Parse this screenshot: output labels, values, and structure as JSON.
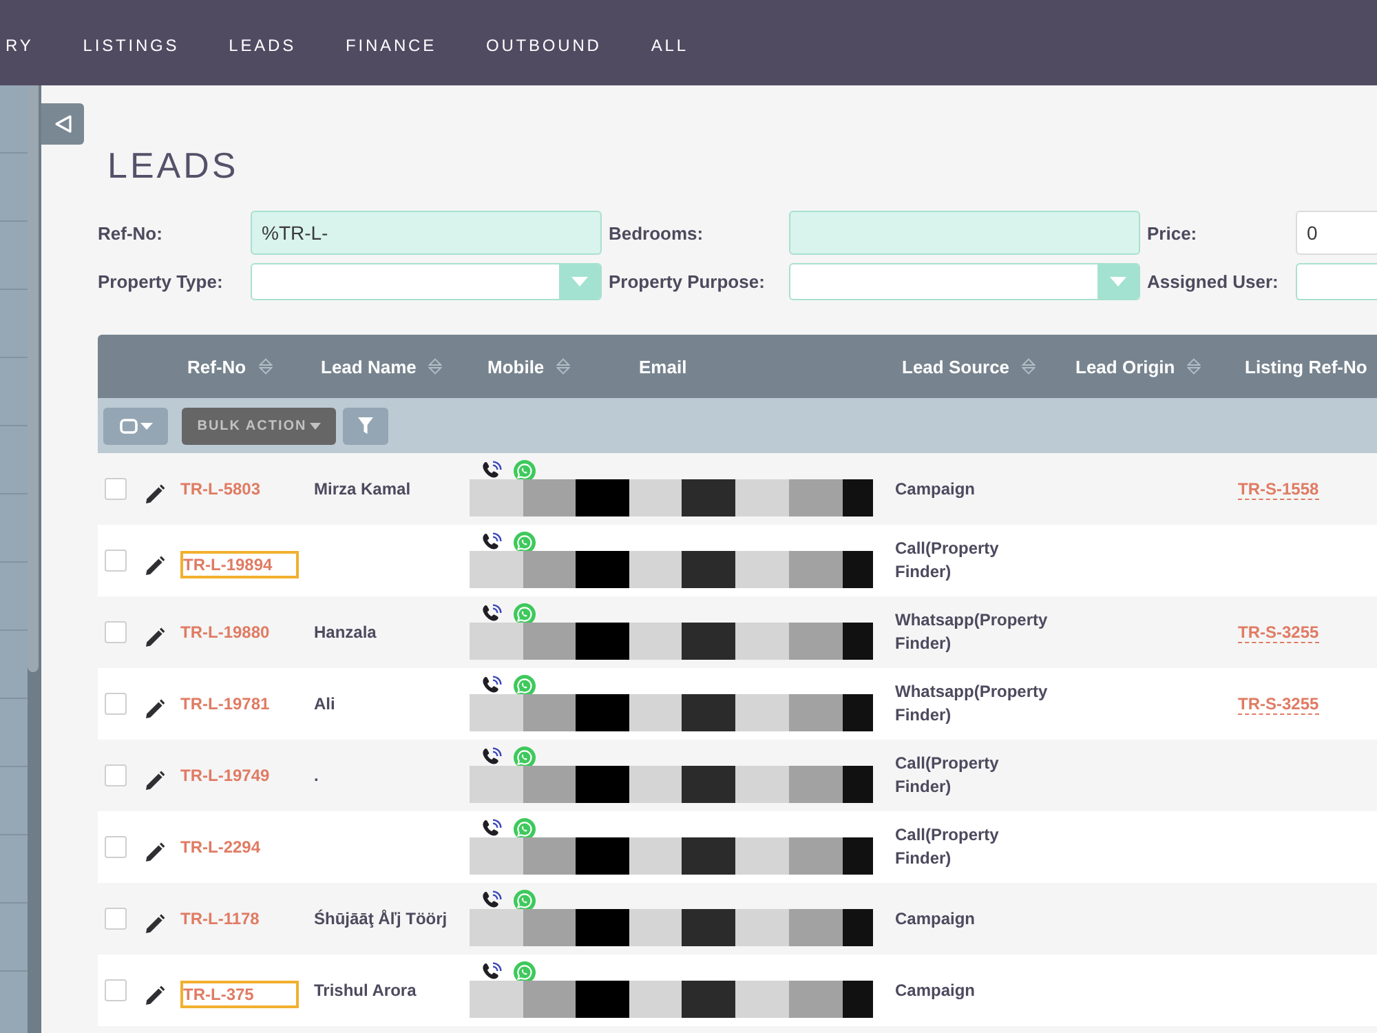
{
  "top_nav": {
    "items": [
      "RY",
      "LISTINGS",
      "LEADS",
      "FINANCE",
      "OUTBOUND",
      "ALL"
    ]
  },
  "page": {
    "title": "LEADS"
  },
  "filters": [
    {
      "label": "Ref-No:",
      "kind": "text",
      "highlighted": true,
      "value": "%TR-L-"
    },
    {
      "label": "Bedrooms:",
      "kind": "text",
      "highlighted": true
    },
    {
      "label": "Price:",
      "kind": "text",
      "highlighted": false,
      "value": "0"
    },
    {
      "label": "Property Type:",
      "kind": "select",
      "highlighted": false
    },
    {
      "label": "Property Purpose:",
      "kind": "select",
      "highlighted": false
    },
    {
      "label": "Assigned User:",
      "kind": "lookup",
      "highlighted": false
    }
  ],
  "table": {
    "columns": [
      {
        "label": "Ref-No",
        "sortable": true
      },
      {
        "label": "Lead Name",
        "sortable": true
      },
      {
        "label": "Mobile",
        "sortable": true
      },
      {
        "label": "Email",
        "sortable": false
      },
      {
        "label": "Lead Source",
        "sortable": true
      },
      {
        "label": "Lead Origin",
        "sortable": true
      },
      {
        "label": "Listing Ref-No",
        "sortable": false
      }
    ],
    "bulk_action": {
      "label": "BULK ACTION",
      "disabled": true
    },
    "rows": [
      {
        "checked": false,
        "ref": "TR-L-5803",
        "outlined": false,
        "name": "Mirza Kamal",
        "lead_source": "Campaign",
        "listing_ref": "TR-S-1558"
      },
      {
        "checked": false,
        "ref": "TR-L-19894",
        "outlined": true,
        "lead_source": "Call(Property Finder)"
      },
      {
        "checked": false,
        "ref": "TR-L-19880",
        "outlined": false,
        "name": "Hanzala",
        "lead_source": "Whatsapp(Property Finder)",
        "listing_ref": "TR-S-3255"
      },
      {
        "checked": false,
        "ref": "TR-L-19781",
        "outlined": false,
        "name": "Ali",
        "lead_source": "Whatsapp(Property Finder)",
        "listing_ref": "TR-S-3255"
      },
      {
        "checked": false,
        "ref": "TR-L-19749",
        "outlined": false,
        "name": ".",
        "lead_source": "Call(Property Finder)"
      },
      {
        "checked": false,
        "ref": "TR-L-2294",
        "outlined": false,
        "lead_source": "Call(Property Finder)"
      },
      {
        "checked": false,
        "ref": "TR-L-1178",
        "outlined": false,
        "name": "Śhūjāāţ Åľj Töörj",
        "lead_source": "Campaign"
      },
      {
        "checked": false,
        "ref": "TR-L-375",
        "outlined": true,
        "name": "Trishul Arora",
        "lead_source": "Campaign"
      }
    ]
  }
}
